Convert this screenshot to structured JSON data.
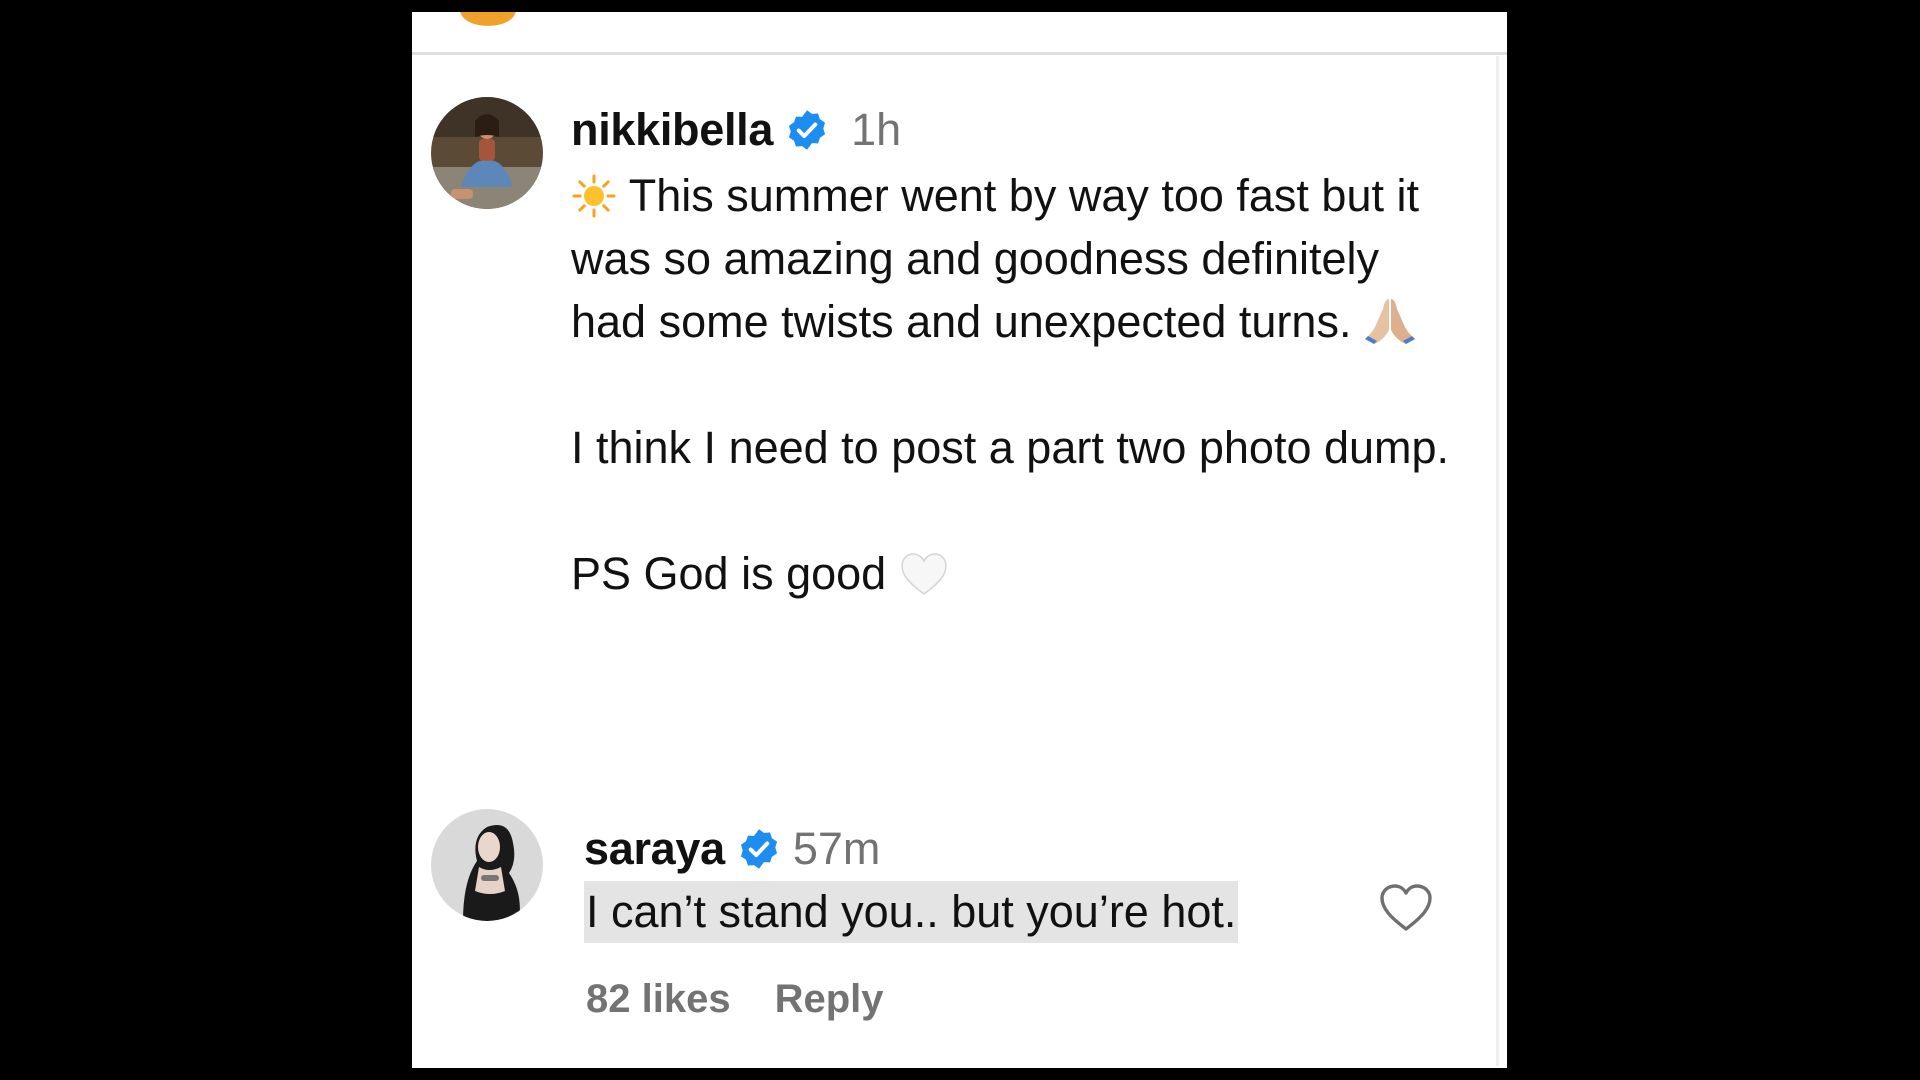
{
  "post": {
    "username": "nikkibella",
    "verified": true,
    "time": "1h",
    "caption_line1_emoji": "sun-emoji",
    "caption_line1": "This summer went by way too fast but it was so amazing and goodness definitely had some twists and unexpected turns.",
    "caption_line1_end_emoji": "folded-hands-emoji",
    "caption_line2": "I think I need to post a part two photo dump.",
    "caption_line3": "PS God is good",
    "caption_line3_end_emoji": "white-heart-emoji"
  },
  "comment": {
    "username": "saraya",
    "verified": true,
    "time": "57m",
    "text": "I can’t stand you.. but you’re hot.",
    "likes": "82 likes",
    "reply_label": "Reply"
  },
  "colors": {
    "verified_blue": "#1e8df2",
    "secondary_text": "#737373",
    "highlight": "#e4e4e4"
  }
}
